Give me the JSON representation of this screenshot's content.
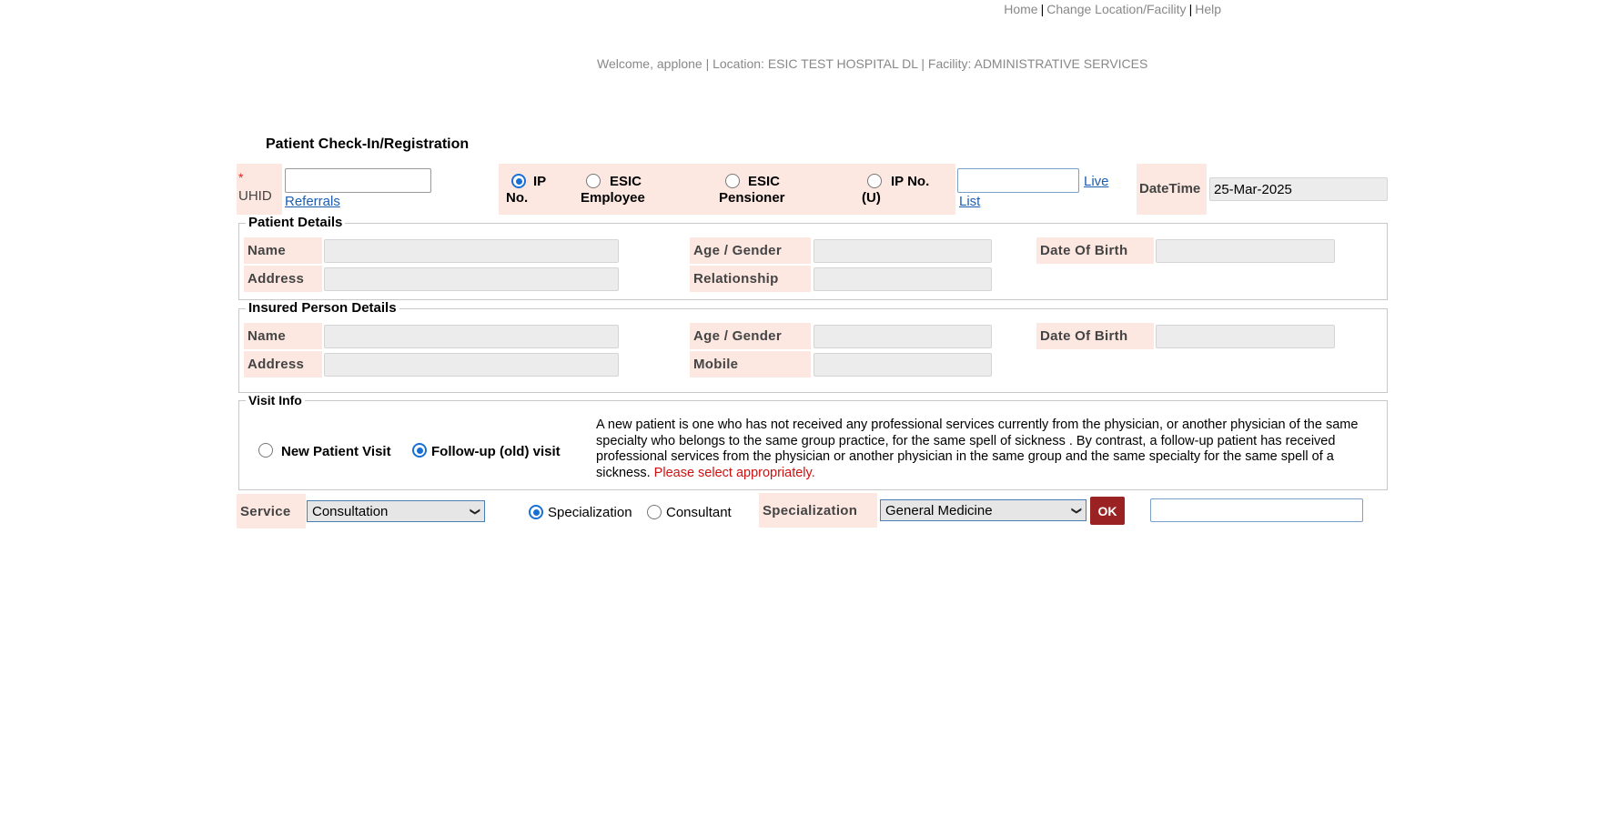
{
  "top_nav": {
    "home": "Home",
    "change": "Change Location/Facility",
    "help": "Help",
    "separator": "|"
  },
  "welcome": "Welcome, applone |  Location: ESIC TEST HOSPITAL DL |  Facility: ADMINISTRATIVE SERVICES",
  "page_title": "Patient Check-In/Registration",
  "search": {
    "required_mark": "*",
    "uhid_label": "UHID",
    "uhid_value": "",
    "referrals_link": "Referrals",
    "radio_ipno_l1": "IP",
    "radio_ipno_l2": "No.",
    "radio_esic_emp_l1": "ESIC",
    "radio_esic_emp_l2": "Employee",
    "radio_esic_pen_l1": "ESIC",
    "radio_esic_pen_l2": "Pensioner",
    "radio_ipnou_l1": "IP No.",
    "radio_ipnou_l2": "(U)",
    "selected": "IP No.",
    "ip_value": "",
    "live_list_l1": "Live",
    "live_list_l2": "List",
    "datetime_label": "DateTime",
    "datetime_value": "25-Mar-2025"
  },
  "patient_details": {
    "legend": "Patient Details",
    "name_label": "Name",
    "name_value": "",
    "age_gender_label": "Age / Gender",
    "age_gender_value": "",
    "dob_label": "Date Of Birth",
    "dob_value": "",
    "address_label": "Address",
    "address_value": "",
    "relationship_label": "Relationship",
    "relationship_value": ""
  },
  "insured_details": {
    "legend": "Insured Person Details",
    "name_label": "Name",
    "name_value": "",
    "age_gender_label": "Age / Gender",
    "age_gender_value": "",
    "dob_label": "Date Of Birth",
    "dob_value": "",
    "address_label": "Address",
    "address_value": "",
    "mobile_label": "Mobile",
    "mobile_value": ""
  },
  "visit_info": {
    "legend": "Visit Info",
    "new_visit": "New Patient Visit",
    "followup_visit": "Follow-up (old) visit",
    "selected": "Follow-up (old) visit",
    "note": "A new patient is one who has not received any professional services currently from the physician, or another physician of the same specialty who belongs to the same group practice, for the same spell of sickness . By contrast, a follow-up patient has received professional services from the physician or another physician in the same group and the same specialty for the same spell of a sickness.",
    "warning": "Please select appropriately."
  },
  "service_row": {
    "service_label": "Service",
    "service_value": "Consultation",
    "radio_specialization": "Specialization",
    "radio_consultant": "Consultant",
    "radio_selected": "Specialization",
    "specialization_label": "Specialization",
    "specialization_value": "General Medicine",
    "ok_label": "OK",
    "extra_value": ""
  }
}
